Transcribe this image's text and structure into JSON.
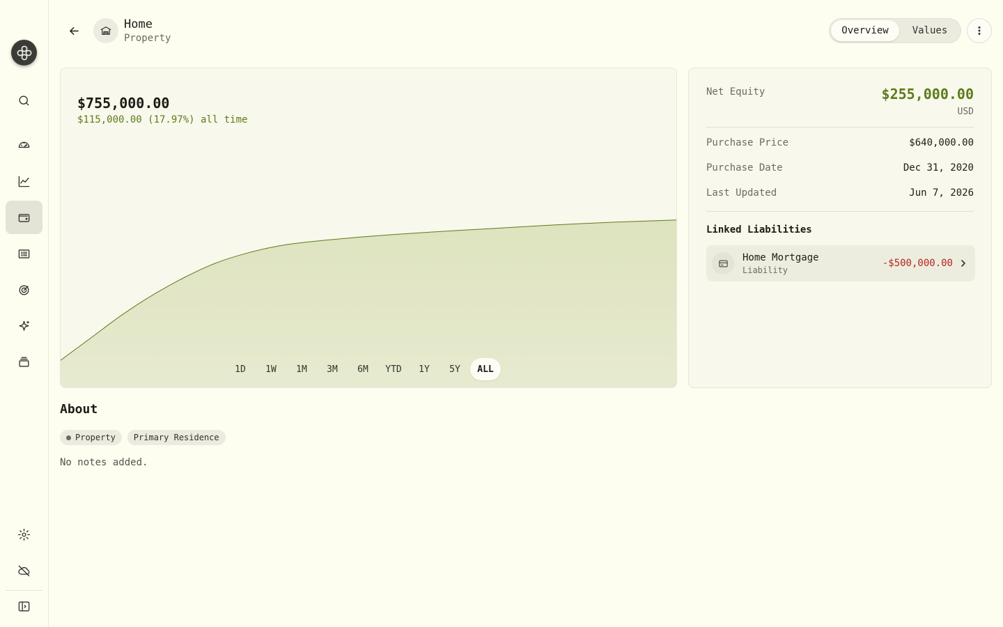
{
  "header": {
    "title": "Home",
    "subtitle": "Property",
    "tabs": [
      "Overview",
      "Values"
    ],
    "active_tab": "Overview"
  },
  "sidebar": {
    "items": [
      "search-icon",
      "dashboard-icon",
      "chart-icon",
      "wallet-icon",
      "receipt-icon",
      "target-icon",
      "sparkle-icon",
      "layers-icon"
    ],
    "bottom": [
      "gear-icon",
      "cloud-off-icon",
      "panel-toggle-icon"
    ],
    "active": "wallet-icon"
  },
  "chart": {
    "value": "$755,000.00",
    "change": "$115,000.00 (17.97%) all time",
    "periods": [
      "1D",
      "1W",
      "1M",
      "3M",
      "6M",
      "YTD",
      "1Y",
      "5Y",
      "ALL"
    ],
    "active_period": "ALL",
    "color": "#5e7a1a"
  },
  "chart_data": {
    "type": "area",
    "x": [
      0,
      0.05,
      0.1,
      0.15,
      0.2,
      0.25,
      0.3,
      0.35,
      0.4,
      0.5,
      0.6,
      0.7,
      0.8,
      0.9,
      1.0
    ],
    "values": [
      640000,
      672000,
      704000,
      732000,
      756000,
      776000,
      790000,
      800000,
      806000,
      814000,
      820000,
      825000,
      830000,
      834000,
      837000
    ],
    "title": "",
    "xlabel": "",
    "ylabel": ""
  },
  "details": {
    "net_equity_label": "Net Equity",
    "net_equity_value": "$255,000.00",
    "currency": "USD",
    "purchase_price_label": "Purchase Price",
    "purchase_price_value": "$640,000.00",
    "purchase_date_label": "Purchase Date",
    "purchase_date_value": "Dec 31, 2020",
    "last_updated_label": "Last Updated",
    "last_updated_value": "Jun 7, 2026",
    "linked_title": "Linked Liabilities",
    "liability": {
      "name": "Home Mortgage",
      "type": "Liability",
      "amount": "-$500,000.00"
    }
  },
  "about": {
    "title": "About",
    "tags": [
      "Property",
      "Primary Residence"
    ],
    "notes": "No notes added."
  }
}
